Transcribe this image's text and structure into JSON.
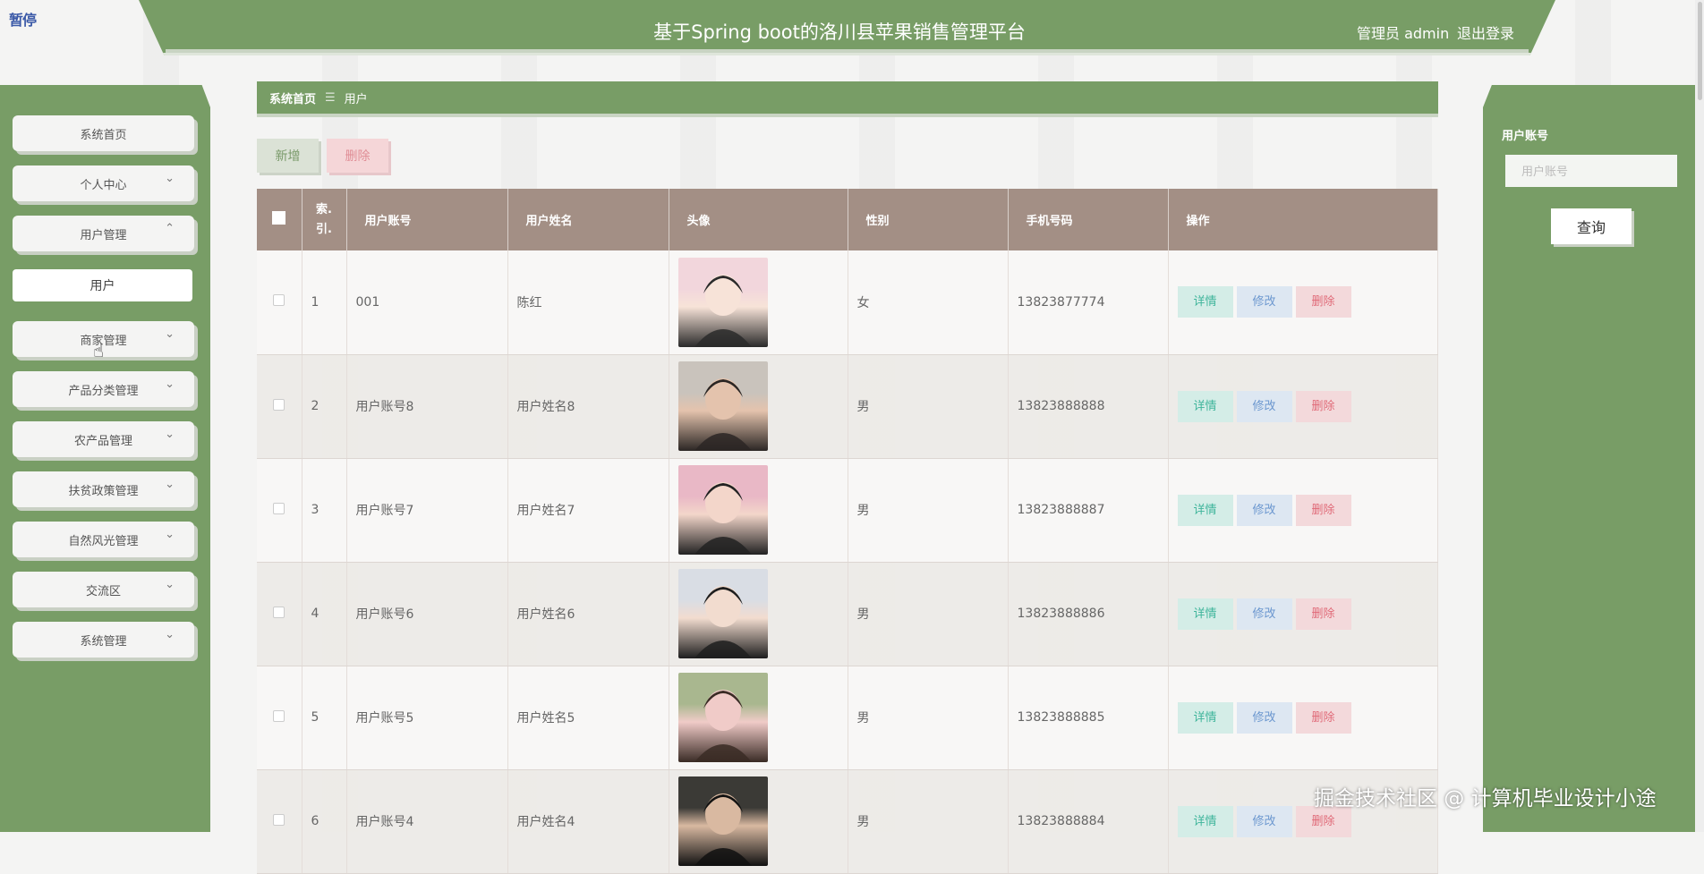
{
  "header": {
    "title": "基于Spring boot的洛川县苹果销售管理平台",
    "admin_label": "管理员 admin",
    "logout_label": "退出登录",
    "pause_badge": "暂停"
  },
  "sidebar": {
    "items": [
      {
        "label": "系统首页",
        "has_chevron": false
      },
      {
        "label": "个人中心",
        "chevron": "⌄"
      },
      {
        "label": "用户管理",
        "chevron": "⌃"
      },
      {
        "label": "商家管理",
        "chevron": "⌄"
      },
      {
        "label": "产品分类管理",
        "chevron": "⌄"
      },
      {
        "label": "农产品管理",
        "chevron": "⌄"
      },
      {
        "label": "扶贫政策管理",
        "chevron": "⌄"
      },
      {
        "label": "自然风光管理",
        "chevron": "⌄"
      },
      {
        "label": "交流区",
        "chevron": "⌄"
      },
      {
        "label": "系统管理",
        "chevron": "⌄"
      }
    ],
    "sub_item": "用户"
  },
  "breadcrumb": {
    "home": "系统首页",
    "separator": "☰",
    "current": "用户"
  },
  "toolbar": {
    "add_label": "新增",
    "delete_label": "删除"
  },
  "search": {
    "label": "用户账号",
    "placeholder": "用户账号",
    "button_label": "查询"
  },
  "table": {
    "headers": [
      "索引",
      "用户账号",
      "用户姓名",
      "头像",
      "性别",
      "手机号码",
      "操作"
    ],
    "index_header_line1": "索.",
    "index_header_line2": "引.",
    "actions": {
      "detail": "详情",
      "edit": "修改",
      "delete": "删除"
    },
    "rows": [
      {
        "index": "1",
        "account": "001",
        "name": "陈红",
        "gender": "女",
        "phone": "13823877774",
        "avatar_colors": [
          "#f2d6dc",
          "#2a2a2a",
          "#f7e3d8"
        ]
      },
      {
        "index": "2",
        "account": "用户账号8",
        "name": "用户姓名8",
        "gender": "男",
        "phone": "13823888888",
        "avatar_colors": [
          "#c9c3bc",
          "#2b2624",
          "#e4c3ad"
        ]
      },
      {
        "index": "3",
        "account": "用户账号7",
        "name": "用户姓名7",
        "gender": "男",
        "phone": "13823888887",
        "avatar_colors": [
          "#e9b8c6",
          "#222",
          "#f3d6ca"
        ]
      },
      {
        "index": "4",
        "account": "用户账号6",
        "name": "用户姓名6",
        "gender": "男",
        "phone": "13823888886",
        "avatar_colors": [
          "#d9dde4",
          "#1e1e1e",
          "#f2dccf"
        ]
      },
      {
        "index": "5",
        "account": "用户账号5",
        "name": "用户姓名5",
        "gender": "男",
        "phone": "13823888885",
        "avatar_colors": [
          "#a9b78f",
          "#3a2b25",
          "#f0cbc8"
        ]
      },
      {
        "index": "6",
        "account": "用户账号4",
        "name": "用户姓名4",
        "gender": "男",
        "phone": "13823888884",
        "avatar_colors": [
          "#3b3a36",
          "#111",
          "#d9b9a1"
        ]
      }
    ]
  },
  "watermark": "掘金技术社区 @ 计算机毕业设计小途",
  "colors": {
    "accent_green": "#789d66",
    "table_header": "#a38f85",
    "detail": "#3fb59b",
    "edit": "#6b97cf",
    "delete": "#e06a78"
  }
}
